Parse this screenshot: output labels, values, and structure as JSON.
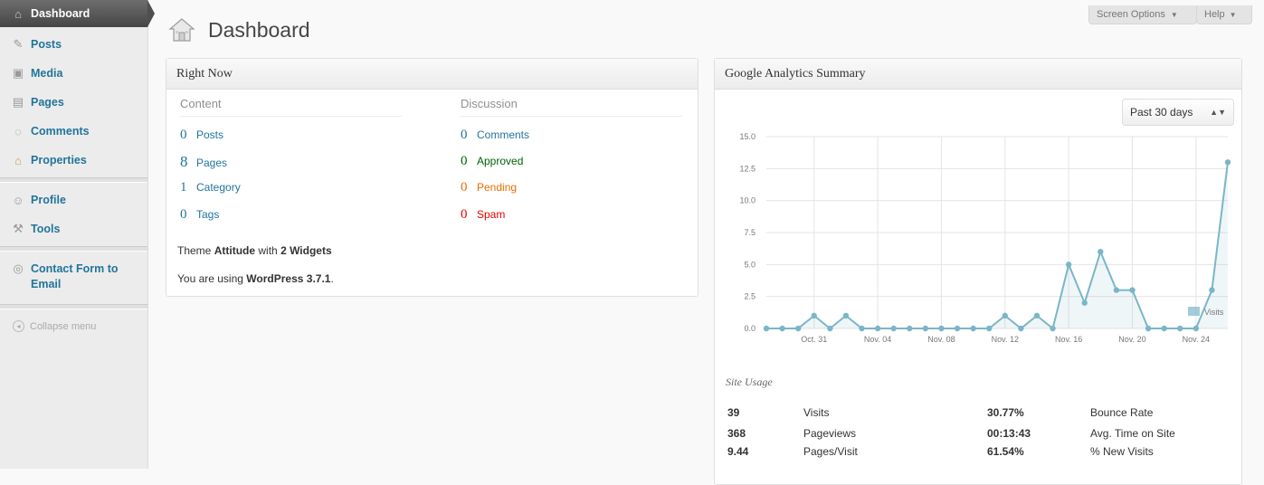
{
  "sidebar": {
    "items": [
      {
        "label": "Dashboard",
        "icon": "house-icon"
      },
      {
        "label": "Posts",
        "icon": "pin-icon"
      },
      {
        "label": "Media",
        "icon": "media-icon"
      },
      {
        "label": "Pages",
        "icon": "pages-icon"
      },
      {
        "label": "Comments",
        "icon": "comment-icon"
      },
      {
        "label": "Properties",
        "icon": "property-icon"
      },
      {
        "label": "Profile",
        "icon": "profile-icon"
      },
      {
        "label": "Tools",
        "icon": "tools-icon"
      },
      {
        "label": "Contact Form to Email",
        "icon": "contact-icon"
      }
    ],
    "collapse_label": "Collapse menu"
  },
  "header": {
    "title": "Dashboard",
    "screen_options": "Screen Options",
    "help": "Help"
  },
  "right_now": {
    "title": "Right Now",
    "content_heading": "Content",
    "discussion_heading": "Discussion",
    "content": [
      {
        "count": "0",
        "label": "Posts"
      },
      {
        "count": "8",
        "label": "Pages"
      },
      {
        "count": "1",
        "label": "Category"
      },
      {
        "count": "0",
        "label": "Tags"
      }
    ],
    "discussion": [
      {
        "count": "0",
        "label": "Comments",
        "color": "#21759b"
      },
      {
        "count": "0",
        "label": "Approved",
        "color": "#006505"
      },
      {
        "count": "0",
        "label": "Pending",
        "color": "#e66f00"
      },
      {
        "count": "0",
        "label": "Spam",
        "color": "#e00000"
      }
    ],
    "theme_prefix": "Theme",
    "theme_name": "Attitude",
    "theme_with": "with",
    "widgets": "2 Widgets",
    "version_prefix": "You are using",
    "version": "WordPress 3.7.1",
    "version_suffix": "."
  },
  "analytics": {
    "title": "Google Analytics Summary",
    "range": "Past 30 days",
    "site_usage_label": "Site Usage",
    "usage": [
      {
        "value": "39",
        "label": "Visits",
        "value2": "30.77%",
        "label2": "Bounce Rate"
      },
      {
        "value": "368",
        "label": "Pageviews",
        "value2": "00:13:43",
        "label2": "Avg. Time on Site"
      },
      {
        "value": "9.44",
        "label": "Pages/Visit",
        "value2": "61.54%",
        "label2": "% New Visits"
      }
    ]
  },
  "chart_data": {
    "type": "line",
    "title": "",
    "xlabel": "",
    "ylabel": "",
    "ylim": [
      0,
      15
    ],
    "yticks": [
      "0.0",
      "2.5",
      "5.0",
      "7.5",
      "10.0",
      "12.5",
      "15.0"
    ],
    "xticks": [
      "Oct. 31",
      "Nov. 04",
      "Nov. 08",
      "Nov. 12",
      "Nov. 16",
      "Nov. 20",
      "Nov. 24"
    ],
    "grid": true,
    "legend_position": "bottom-right",
    "color": "#7ab6c8",
    "series": [
      {
        "name": "Visits",
        "x": [
          "Oct. 28",
          "Oct. 29",
          "Oct. 30",
          "Oct. 31",
          "Nov. 01",
          "Nov. 02",
          "Nov. 03",
          "Nov. 04",
          "Nov. 05",
          "Nov. 06",
          "Nov. 07",
          "Nov. 08",
          "Nov. 09",
          "Nov. 10",
          "Nov. 11",
          "Nov. 12",
          "Nov. 13",
          "Nov. 14",
          "Nov. 15",
          "Nov. 16",
          "Nov. 17",
          "Nov. 18",
          "Nov. 19",
          "Nov. 20",
          "Nov. 21",
          "Nov. 22",
          "Nov. 23",
          "Nov. 24",
          "Nov. 25",
          "Nov. 26"
        ],
        "values": [
          0,
          0,
          0,
          1,
          0,
          1,
          0,
          0,
          0,
          0,
          0,
          0,
          0,
          0,
          0,
          1,
          0,
          1,
          0,
          5,
          2,
          6,
          3,
          3,
          0,
          0,
          0,
          0,
          3,
          13
        ]
      }
    ]
  }
}
